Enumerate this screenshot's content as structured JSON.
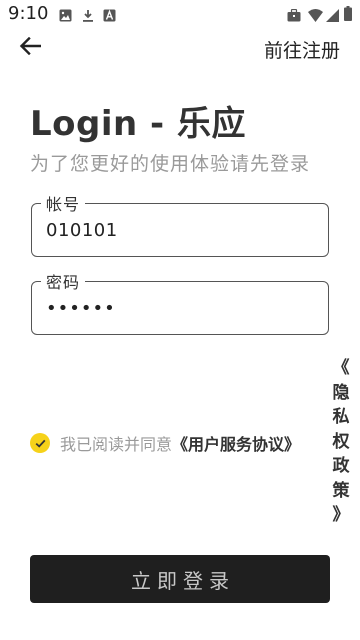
{
  "status_bar": {
    "time": "9:10",
    "left_icons": [
      "image-icon",
      "download-icon",
      "font-icon"
    ],
    "right_icons": [
      "briefcase-icon",
      "wifi-icon",
      "signal-icon",
      "battery-icon"
    ]
  },
  "header": {
    "back_icon": "arrow-left-icon",
    "register_label": "前往注册"
  },
  "title": "Login - 乐应",
  "subtitle": "为了您更好的使用体验请先登录",
  "account_field": {
    "label": "帐号",
    "value": "010101"
  },
  "password_field": {
    "label": "密码",
    "value": "••••••"
  },
  "agreement": {
    "checked": true,
    "prefix": "我已阅读并同意",
    "user_agreement": "《用户服务协议》",
    "privacy_policy": [
      "《",
      "隐",
      "私",
      "权",
      "政",
      "策",
      "》"
    ]
  },
  "login_button": "立即登录",
  "colors": {
    "accent": "#f6d21a",
    "button_bg": "#1f1f1f",
    "subtitle_gray": "#9a9a9a"
  }
}
